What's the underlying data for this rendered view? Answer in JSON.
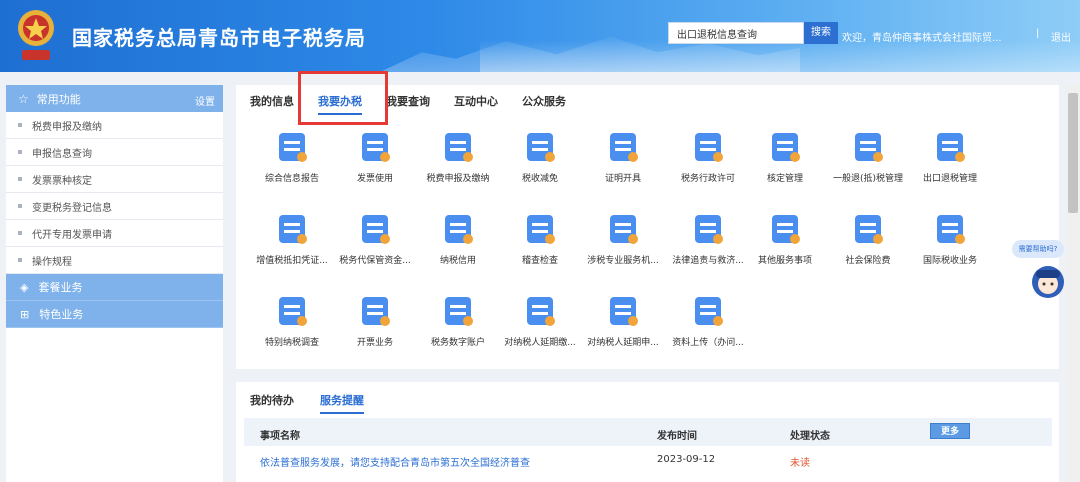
{
  "header": {
    "title": "国家税务总局青岛市电子税务局",
    "search_value": "出口退税信息查询",
    "search_button": "搜索",
    "welcome": "欢迎，青岛仲商事株式会社国际贸...",
    "separator": "|",
    "logout": "退出"
  },
  "sidebar": {
    "header": {
      "label": "常用功能",
      "settings": "设置"
    },
    "items": [
      {
        "label": "税费申报及缴纳"
      },
      {
        "label": "申报信息查询"
      },
      {
        "label": "发票票种核定"
      },
      {
        "label": "变更税务登记信息"
      },
      {
        "label": "代开专用发票申请"
      },
      {
        "label": "操作规程"
      }
    ],
    "groups": [
      {
        "label": "套餐业务",
        "icon": "layers-icon"
      },
      {
        "label": "特色业务",
        "icon": "grid-icon"
      }
    ]
  },
  "main": {
    "tabs": [
      {
        "label": "我的信息"
      },
      {
        "label": "我要办税",
        "active": true
      },
      {
        "label": "我要查询"
      },
      {
        "label": "互动中心"
      },
      {
        "label": "公众服务"
      }
    ],
    "tiles": [
      {
        "label": "综合信息报告",
        "icon": "document-stack-icon"
      },
      {
        "label": "发票使用",
        "icon": "invoice-icon"
      },
      {
        "label": "税费申报及缴纳",
        "icon": "handshake-payment-icon"
      },
      {
        "label": "税收减免",
        "icon": "tax-relief-icon"
      },
      {
        "label": "证明开具",
        "icon": "certificate-icon"
      },
      {
        "label": "税务行政许可",
        "icon": "license-icon"
      },
      {
        "label": "核定管理",
        "icon": "check-board-icon"
      },
      {
        "label": "一般退(抵)税管理",
        "icon": "refund-hand-icon"
      },
      {
        "label": "出口退税管理",
        "icon": "export-refund-icon"
      },
      {
        "label": "增值税抵扣凭证...",
        "icon": "vat-voucher-icon"
      },
      {
        "label": "税务代保管资金...",
        "icon": "custody-fund-icon"
      },
      {
        "label": "纳税信用",
        "icon": "credit-badge-icon"
      },
      {
        "label": "稽查检查",
        "icon": "inspection-icon"
      },
      {
        "label": "涉税专业服务机...",
        "icon": "briefcase-icon"
      },
      {
        "label": "法律追责与救济...",
        "icon": "scales-icon"
      },
      {
        "label": "其他服务事项",
        "icon": "blocks-icon"
      },
      {
        "label": "社会保险费",
        "icon": "shield-insurance-icon"
      },
      {
        "label": "国际税收业务",
        "icon": "globe-icon"
      },
      {
        "label": "特别纳税调查",
        "icon": "edit-doc-icon"
      },
      {
        "label": "开票业务",
        "icon": "print-invoice-icon"
      },
      {
        "label": "税务数字账户",
        "icon": "digital-account-icon"
      },
      {
        "label": "对纳税人延期缴...",
        "icon": "delay-payment-icon"
      },
      {
        "label": "对纳税人延期申...",
        "icon": "delay-declare-icon"
      },
      {
        "label": "资料上传（办问...",
        "icon": "upload-doc-icon"
      }
    ]
  },
  "todo": {
    "tabs": [
      {
        "label": "我的待办"
      },
      {
        "label": "服务提醒",
        "active": true
      }
    ],
    "columns": {
      "name": "事项名称",
      "date": "发布时间",
      "status": "处理状态"
    },
    "more_button": "更多",
    "rows": [
      {
        "name": "依法普查服务发展，请您支持配合青岛市第五次全国经济普查",
        "date": "2023-09-12",
        "status": "未读"
      }
    ]
  },
  "float": {
    "badge": "需要帮助吗?"
  },
  "colors": {
    "accent": "#2b6ed3",
    "sidebar": "#7fb2ea",
    "unread": "#e0552f",
    "link": "#2b6ed3"
  }
}
